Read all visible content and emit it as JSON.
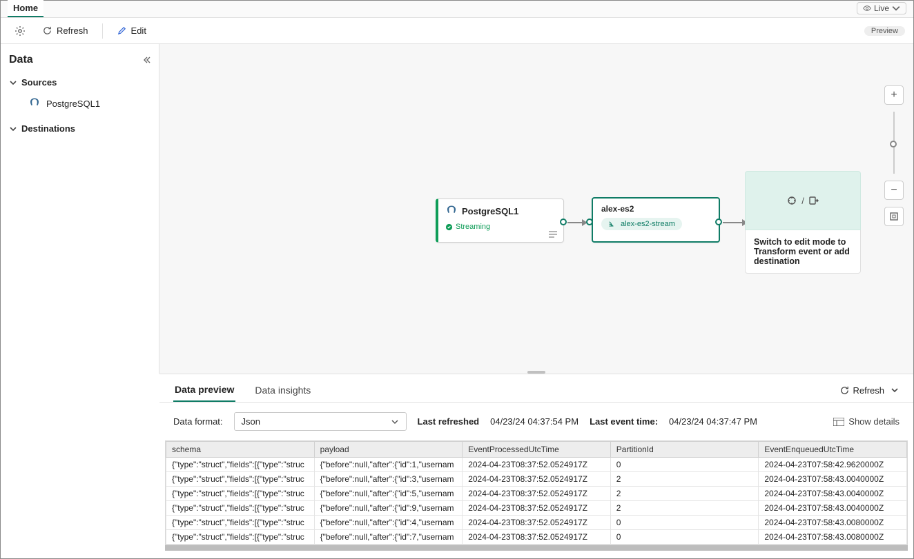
{
  "tabs": {
    "home": "Home"
  },
  "live": {
    "label": "Live"
  },
  "toolbar": {
    "refresh": "Refresh",
    "edit": "Edit",
    "preview_badge": "Preview"
  },
  "sidebar": {
    "title": "Data",
    "sources_label": "Sources",
    "destinations_label": "Destinations",
    "sources": [
      {
        "label": "PostgreSQL1"
      }
    ]
  },
  "canvas": {
    "source": {
      "title": "PostgreSQL1",
      "status": "Streaming"
    },
    "stream": {
      "title": "alex-es2",
      "stream_name": "alex-es2-stream"
    },
    "destination": {
      "hint": "Switch to edit mode to Transform event or add destination"
    }
  },
  "bottom": {
    "tabs": {
      "preview": "Data preview",
      "insights": "Data insights"
    },
    "refresh_label": "Refresh",
    "format_label": "Data format:",
    "format_value": "Json",
    "last_refreshed_label": "Last refreshed",
    "last_refreshed_value": "04/23/24 04:37:54 PM",
    "last_event_label": "Last event time:",
    "last_event_value": "04/23/24 04:37:47 PM",
    "show_details": "Show details",
    "columns": [
      "schema",
      "payload",
      "EventProcessedUtcTime",
      "PartitionId",
      "EventEnqueuedUtcTime"
    ],
    "rows": [
      {
        "schema": "{\"type\":\"struct\",\"fields\":[{\"type\":\"struc",
        "payload": "{\"before\":null,\"after\":{\"id\":1,\"usernam",
        "EventProcessedUtcTime": "2024-04-23T08:37:52.0524917Z",
        "PartitionId": "0",
        "EventEnqueuedUtcTime": "2024-04-23T07:58:42.9620000Z"
      },
      {
        "schema": "{\"type\":\"struct\",\"fields\":[{\"type\":\"struc",
        "payload": "{\"before\":null,\"after\":{\"id\":3,\"usernam",
        "EventProcessedUtcTime": "2024-04-23T08:37:52.0524917Z",
        "PartitionId": "2",
        "EventEnqueuedUtcTime": "2024-04-23T07:58:43.0040000Z"
      },
      {
        "schema": "{\"type\":\"struct\",\"fields\":[{\"type\":\"struc",
        "payload": "{\"before\":null,\"after\":{\"id\":5,\"usernam",
        "EventProcessedUtcTime": "2024-04-23T08:37:52.0524917Z",
        "PartitionId": "2",
        "EventEnqueuedUtcTime": "2024-04-23T07:58:43.0040000Z"
      },
      {
        "schema": "{\"type\":\"struct\",\"fields\":[{\"type\":\"struc",
        "payload": "{\"before\":null,\"after\":{\"id\":9,\"usernam",
        "EventProcessedUtcTime": "2024-04-23T08:37:52.0524917Z",
        "PartitionId": "2",
        "EventEnqueuedUtcTime": "2024-04-23T07:58:43.0040000Z"
      },
      {
        "schema": "{\"type\":\"struct\",\"fields\":[{\"type\":\"struc",
        "payload": "{\"before\":null,\"after\":{\"id\":4,\"usernam",
        "EventProcessedUtcTime": "2024-04-23T08:37:52.0524917Z",
        "PartitionId": "0",
        "EventEnqueuedUtcTime": "2024-04-23T07:58:43.0080000Z"
      },
      {
        "schema": "{\"type\":\"struct\",\"fields\":[{\"type\":\"struc",
        "payload": "{\"before\":null,\"after\":{\"id\":7,\"usernam",
        "EventProcessedUtcTime": "2024-04-23T08:37:52.0524917Z",
        "PartitionId": "0",
        "EventEnqueuedUtcTime": "2024-04-23T07:58:43.0080000Z"
      }
    ]
  }
}
